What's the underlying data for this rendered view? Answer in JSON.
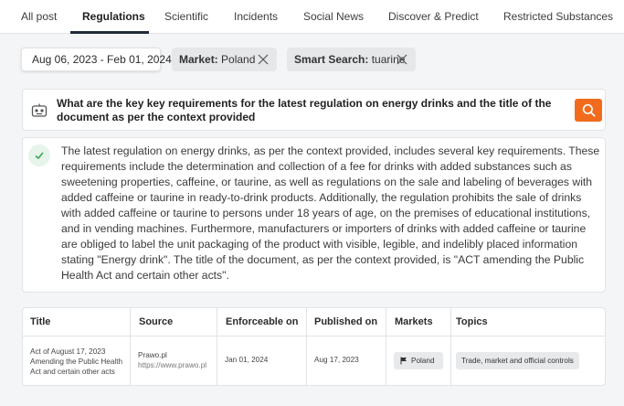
{
  "tabs": [
    {
      "label": "All post"
    },
    {
      "label": "Regulations"
    },
    {
      "label": "Scientific"
    },
    {
      "label": "Incidents"
    },
    {
      "label": "Social News"
    },
    {
      "label": "Discover & Predict"
    },
    {
      "label": "Restricted Substances"
    }
  ],
  "filters": {
    "date_range": "Aug 06, 2023 - Feb 01, 2024",
    "market_key": "Market:",
    "market_value": "Poland",
    "smart_search_key": "Smart Search:",
    "smart_search_value": "tuarine"
  },
  "query": {
    "text": "What are the key key requirements for the latest regulation on energy drinks and the title of the document as per the context provided"
  },
  "answer": {
    "text": "The latest regulation on energy drinks, as per the context provided, includes several key requirements. These requirements include the determination and collection of a fee for drinks with added substances such as sweetening properties, caffeine, or taurine, as well as regulations on the sale and labeling of beverages with added caffeine or taurine in ready-to-drink products. Additionally, the regulation prohibits the sale of drinks with added caffeine or taurine to persons under 18 years of age, on the premises of educational institutions, and in vending machines. Furthermore, manufacturers or importers of drinks with added caffeine or taurine are obliged to label the unit packaging of the product with visible, legible, and indelibly placed information stating \"Energy drink\". The title of the document, as per the context provided, is \"ACT amending the Public Health Act and certain other acts\"."
  },
  "table": {
    "headers": {
      "title": "Title",
      "source": "Source",
      "enforceable": "Enforceable on",
      "published": "Published on",
      "markets": "Markets",
      "topics": "Topics"
    },
    "rows": [
      {
        "title": "Act of August 17, 2023 Amending the Public Health Act and certain other acts",
        "source_name": "Prawo.pl",
        "source_url": "https://www.prawo.pl",
        "enforceable": "Jan 01, 2024",
        "published": "Aug 17, 2023",
        "market": "Poland",
        "topic": "Trade, market and official controls"
      }
    ]
  },
  "colors": {
    "accent": "#f26b1d",
    "active_tab": "#1f2a3a",
    "check": "#3aa757"
  }
}
